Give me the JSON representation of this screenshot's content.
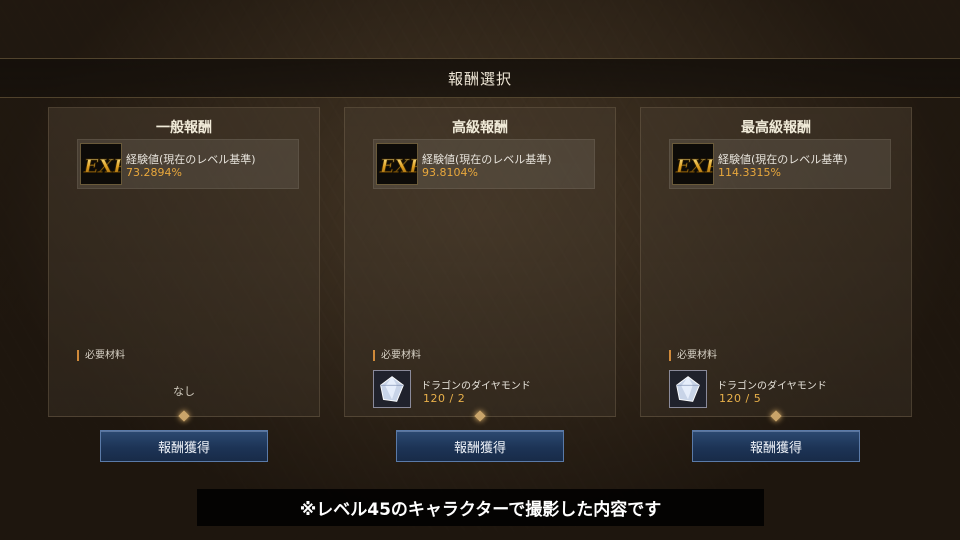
{
  "header": {
    "title": "報酬選択"
  },
  "panels": [
    {
      "title": "一般報酬",
      "reward": {
        "icon": "exp-icon",
        "name": "経験値(現在のレベル基準)",
        "value": "73.2894%"
      },
      "required_label": "必要材料",
      "material": null,
      "none_text": "なし",
      "button_label": "報酬獲得"
    },
    {
      "title": "高級報酬",
      "reward": {
        "icon": "exp-icon",
        "name": "経験値(現在のレベル基準)",
        "value": "93.8104%"
      },
      "required_label": "必要材料",
      "material": {
        "icon": "dragon-diamond-icon",
        "name": "ドラゴンのダイヤモンド",
        "count": "120 / 2"
      },
      "button_label": "報酬獲得"
    },
    {
      "title": "最高級報酬",
      "reward": {
        "icon": "exp-icon",
        "name": "経験値(現在のレベル基準)",
        "value": "114.3315%"
      },
      "required_label": "必要材料",
      "material": {
        "icon": "dragon-diamond-icon",
        "name": "ドラゴンのダイヤモンド",
        "count": "120 / 5"
      },
      "button_label": "報酬獲得"
    }
  ],
  "footer": {
    "note": "※レベル45のキャラクターで撮影した内容です"
  },
  "colors": {
    "reward_value": "#e9a83c",
    "button": "#1d3456",
    "accent_marker": "#d08a3a"
  }
}
